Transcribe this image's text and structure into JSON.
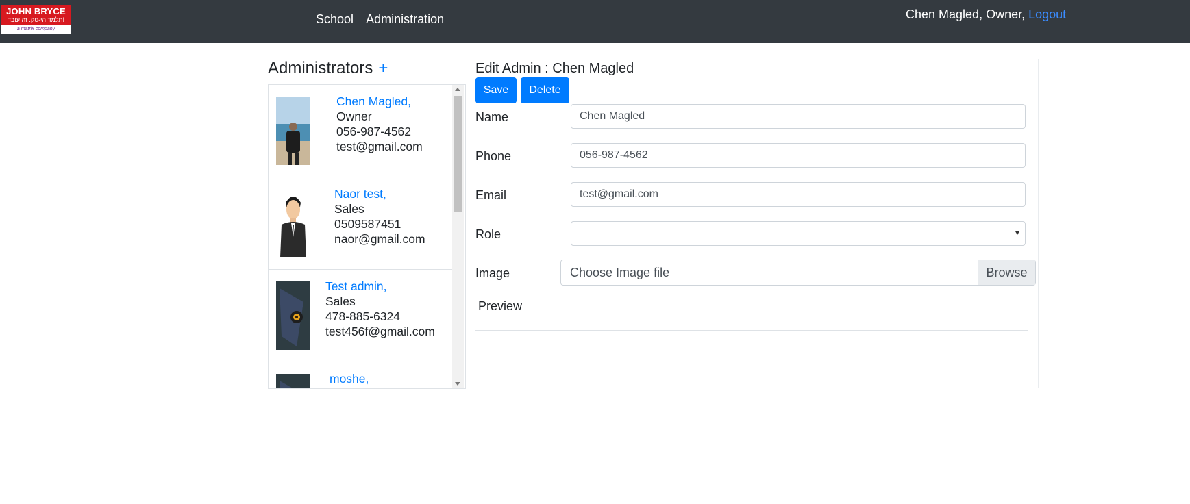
{
  "logo": {
    "brand": "JOHN BRYCE",
    "hebrew_tagline": "תלמד הי-טק. זה עובד!",
    "company_tag": "a matrix company"
  },
  "nav": {
    "links": [
      "School",
      "Administration"
    ],
    "user": "Chen Magled, Owner,",
    "logout": "Logout"
  },
  "admins": {
    "title": "Administrators",
    "add_icon": "+",
    "items": [
      {
        "name": "Chen Magled,",
        "role": "Owner",
        "phone": "056-987-4562",
        "email": "test@gmail.com",
        "photo": "beach-photo"
      },
      {
        "name": "Naor test,",
        "role": "Sales",
        "phone": "0509587451",
        "email": "naor@gmail.com",
        "photo": "businessman-avatar"
      },
      {
        "name": "Test admin,",
        "role": "Sales",
        "phone": "478-885-6324",
        "email": "test456f@gmail.com",
        "photo": "dark-abstract"
      },
      {
        "name": "moshe,",
        "role": "",
        "phone": "",
        "email": "",
        "photo": "dark-abstract"
      }
    ]
  },
  "edit": {
    "title": "Edit Admin : Chen Magled",
    "save": "Save",
    "delete": "Delete",
    "fields": {
      "name_label": "Name",
      "name_value": "Chen Magled",
      "phone_label": "Phone",
      "phone_value": "056-987-4562",
      "email_label": "Email",
      "email_value": "test@gmail.com",
      "role_label": "Role",
      "role_value": "",
      "image_label": "Image",
      "image_placeholder": "Choose Image file",
      "browse": "Browse"
    },
    "preview_label": "Preview"
  },
  "colors": {
    "navbar": "#343a40",
    "primary": "#007bff",
    "logo_red": "#d71920"
  }
}
